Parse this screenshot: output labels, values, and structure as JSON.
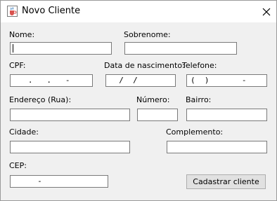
{
  "window": {
    "title": "Novo Cliente"
  },
  "form": {
    "nome": {
      "label": "Nome:",
      "value": ""
    },
    "sobrenome": {
      "label": "Sobrenome:",
      "value": ""
    },
    "cpf": {
      "label": "CPF:",
      "value": "   .   .   -"
    },
    "data_nascimento": {
      "label": "Data de nascimento:",
      "value": "  /  /"
    },
    "telefone": {
      "label": "Telefone:",
      "value": "(  )       -"
    },
    "endereco": {
      "label": "Endereço (Rua):",
      "value": ""
    },
    "numero": {
      "label": "Número:",
      "value": ""
    },
    "bairro": {
      "label": "Bairro:",
      "value": ""
    },
    "cidade": {
      "label": "Cidade:",
      "value": ""
    },
    "complemento": {
      "label": "Complemento:",
      "value": ""
    },
    "cep": {
      "label": "CEP:",
      "value": "     -"
    }
  },
  "actions": {
    "submit_label": "Cadastrar cliente"
  },
  "icons": {
    "app": "java-coffee-cup-icon",
    "close": "close-icon"
  },
  "colors": {
    "window_background": "#f0f0f0",
    "titlebar_background": "#ffffff",
    "field_border": "#7a7a7a",
    "button_background": "#e1e1e1"
  }
}
